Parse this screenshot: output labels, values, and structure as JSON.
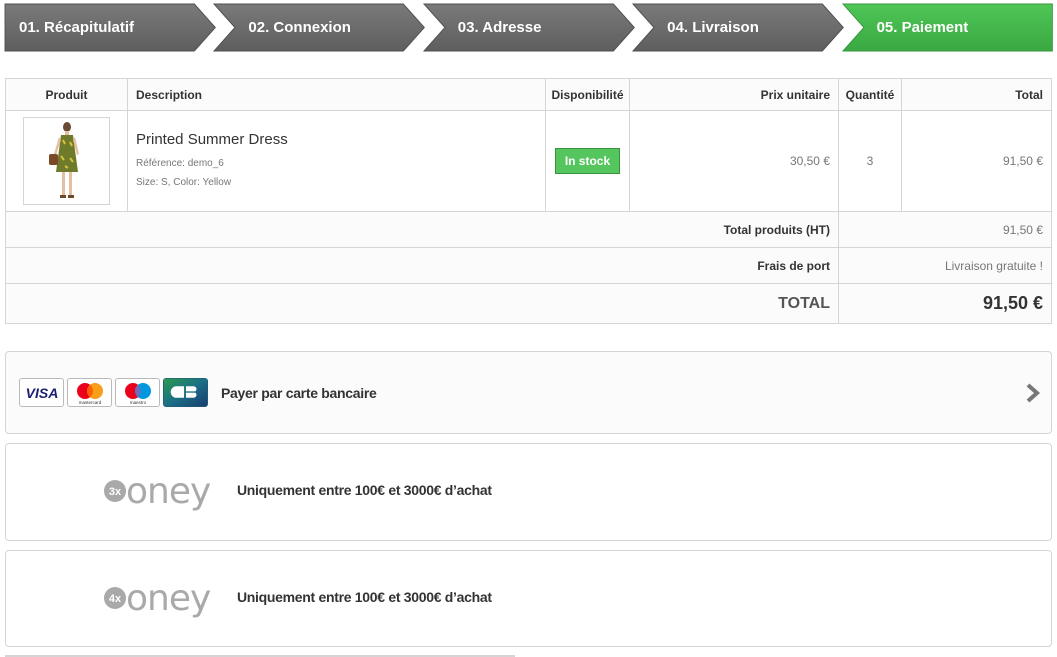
{
  "steps": [
    {
      "label": "01. Récapitulatif",
      "state": "done"
    },
    {
      "label": "02. Connexion",
      "state": "done"
    },
    {
      "label": "03. Adresse",
      "state": "done"
    },
    {
      "label": "04. Livraison",
      "state": "done"
    },
    {
      "label": "05. Paiement",
      "state": "current"
    }
  ],
  "colors": {
    "step_done": "#6b6b6b",
    "step_current": "#45b64c",
    "in_stock": "#55c65e"
  },
  "cart": {
    "headers": {
      "product": "Produit",
      "description": "Description",
      "availability": "Disponibilité",
      "unit_price": "Prix unitaire",
      "quantity": "Quantité",
      "total": "Total"
    },
    "items": [
      {
        "name": "Printed Summer Dress",
        "reference": "Référence: demo_6",
        "attributes": "Size: S, Color: Yellow",
        "availability": "In stock",
        "unit_price": "30,50 €",
        "quantity": "3",
        "total": "91,50 €"
      }
    ],
    "totals": {
      "products_label": "Total produits (HT)",
      "products_value": "91,50 €",
      "shipping_label": "Frais de port",
      "shipping_value": "Livraison gratuite !",
      "total_label": "TOTAL",
      "total_value": "91,50 €"
    }
  },
  "payment": {
    "card_label": "Payer par carte bancaire",
    "card_brands": [
      "VISA",
      "mastercard",
      "maestro",
      "CB"
    ],
    "oney3": {
      "badge": "3x",
      "brand": "oney",
      "text": "Uniquement entre 100€ et 3000€ d’achat"
    },
    "oney4": {
      "badge": "4x",
      "brand": "oney",
      "text": "Uniquement entre 100€ et 3000€ d’achat"
    }
  }
}
